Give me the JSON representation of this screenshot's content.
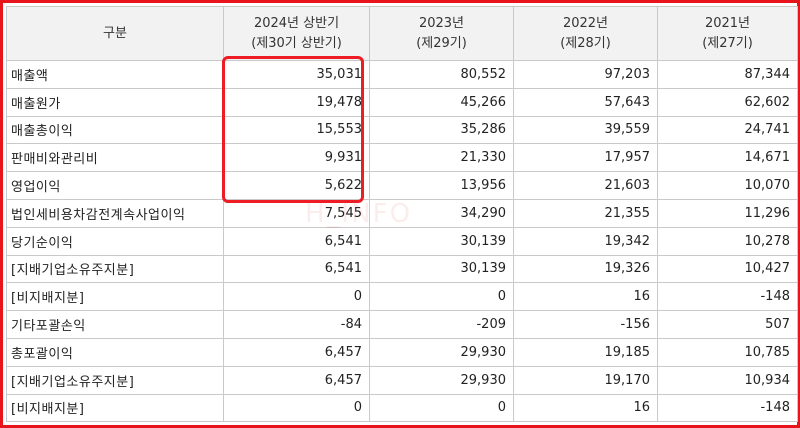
{
  "header": {
    "col0": "구분",
    "cols": [
      {
        "line1": "2024년 상반기",
        "line2": "(제30기 상반기)"
      },
      {
        "line1": "2023년",
        "line2": "(제29기)"
      },
      {
        "line1": "2022년",
        "line2": "(제28기)"
      },
      {
        "line1": "2021년",
        "line2": "(제27기)"
      }
    ]
  },
  "rows": [
    {
      "label": "매출액",
      "values": [
        "35,031",
        "80,552",
        "97,203",
        "87,344"
      ]
    },
    {
      "label": "매출원가",
      "values": [
        "19,478",
        "45,266",
        "57,643",
        "62,602"
      ]
    },
    {
      "label": "매출총이익",
      "values": [
        "15,553",
        "35,286",
        "39,559",
        "24,741"
      ]
    },
    {
      "label": "판매비와관리비",
      "values": [
        "9,931",
        "21,330",
        "17,957",
        "14,671"
      ]
    },
    {
      "label": "영업이익",
      "values": [
        "5,622",
        "13,956",
        "21,603",
        "10,070"
      ]
    },
    {
      "label": "법인세비용차감전계속사업이익",
      "values": [
        "7,545",
        "34,290",
        "21,355",
        "11,296"
      ]
    },
    {
      "label": "당기순이익",
      "values": [
        "6,541",
        "30,139",
        "19,342",
        "10,278"
      ]
    },
    {
      "label": "[지배기업소유주지분]",
      "values": [
        "6,541",
        "30,139",
        "19,326",
        "10,427"
      ]
    },
    {
      "label": "[비지배지분]",
      "values": [
        "0",
        "0",
        "16",
        "-148"
      ]
    },
    {
      "label": "기타포괄손익",
      "values": [
        "-84",
        "-209",
        "-156",
        "507"
      ]
    },
    {
      "label": "총포괄이익",
      "values": [
        "6,457",
        "29,930",
        "19,185",
        "10,785"
      ]
    },
    {
      "label": "[지배기업소유주지분]",
      "values": [
        "6,457",
        "29,930",
        "19,170",
        "10,934"
      ]
    },
    {
      "label": "[비지배지분]",
      "values": [
        "0",
        "0",
        "16",
        "-148"
      ]
    }
  ],
  "watermark": "H_INFO",
  "colors": {
    "frame": "#e8141c",
    "highlight": "#ee1c25",
    "header_bg": "#f2f2f2"
  }
}
